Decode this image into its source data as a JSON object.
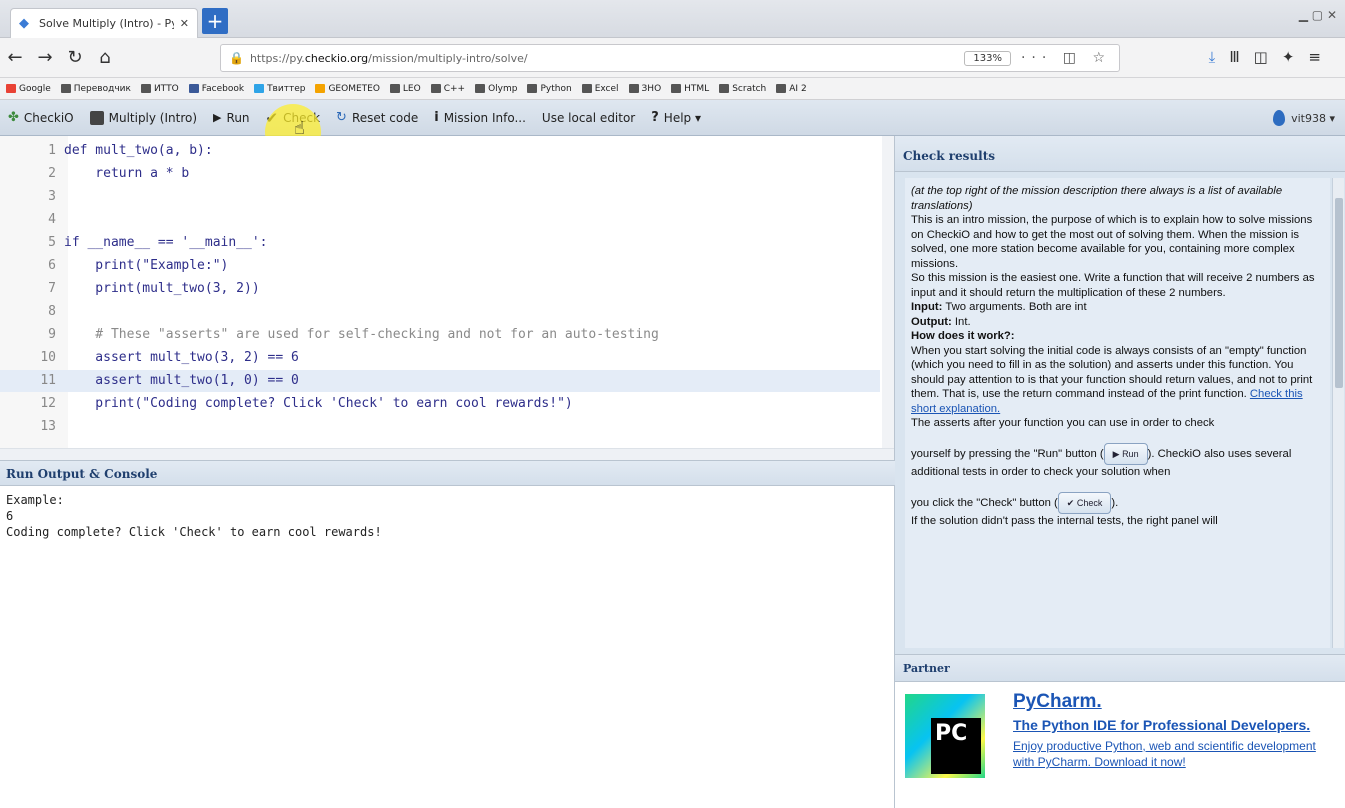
{
  "browser": {
    "tab_title": "Solve Multiply (Intro) - Py.CheckiO",
    "tab_close": "✕",
    "new_tab": "+",
    "url_prefix": "https://py.",
    "url_domain": "checkio.org",
    "url_path": "/mission/multiply-intro/solve/",
    "zoom": "133%",
    "url_more": "···"
  },
  "bookmarks": [
    {
      "label": "Google",
      "kind": "g"
    },
    {
      "label": "Переводчик",
      "kind": ""
    },
    {
      "label": "ИТТО",
      "kind": ""
    },
    {
      "label": "Facebook",
      "kind": "fb"
    },
    {
      "label": "Твиттер",
      "kind": "tw"
    },
    {
      "label": "GEOMETEO",
      "kind": "ge"
    },
    {
      "label": "LEO",
      "kind": ""
    },
    {
      "label": "C++",
      "kind": ""
    },
    {
      "label": "Olymp",
      "kind": ""
    },
    {
      "label": "Python",
      "kind": ""
    },
    {
      "label": "Excel",
      "kind": ""
    },
    {
      "label": "ЗНО",
      "kind": ""
    },
    {
      "label": "HTML",
      "kind": ""
    },
    {
      "label": "Scratch",
      "kind": ""
    },
    {
      "label": "AI 2",
      "kind": ""
    }
  ],
  "toolbar": {
    "logo": "CheckiO",
    "mission": "Multiply (Intro)",
    "run": "Run",
    "check": "Check",
    "reset": "Reset code",
    "mission_info": "Mission Info...",
    "local_editor": "Use local editor",
    "help": "Help",
    "user": "vit938"
  },
  "code_lines": [
    {
      "n": "1",
      "text": "def mult_two(a, b):"
    },
    {
      "n": "2",
      "text": "    return a * b"
    },
    {
      "n": "3",
      "text": ""
    },
    {
      "n": "4",
      "text": ""
    },
    {
      "n": "5",
      "text": "if __name__ == '__main__':"
    },
    {
      "n": "6",
      "text": "    print(\"Example:\")"
    },
    {
      "n": "7",
      "text": "    print(mult_two(3, 2))"
    },
    {
      "n": "8",
      "text": ""
    },
    {
      "n": "9",
      "text": "    # These \"asserts\" are used for self-checking and not for an auto-testing"
    },
    {
      "n": "10",
      "text": "    assert mult_two(3, 2) == 6"
    },
    {
      "n": "11",
      "text": "    assert mult_two(1, 0) == 0"
    },
    {
      "n": "12",
      "text": "    print(\"Coding complete? Click 'Check' to earn cool rewards!\")"
    },
    {
      "n": "13",
      "text": ""
    }
  ],
  "output": {
    "title": "Run Output & Console",
    "text": "Example:\n6\nCoding complete? Click 'Check' to earn cool rewards!"
  },
  "check_results": {
    "title": "Check results",
    "intro_italic": "(at the top right of the mission description there always is a list of available translations)",
    "p1": "This is an intro mission, the purpose of which is to explain how to solve missions on CheckiO and how to get the most out of solving them. When the mission is solved, one more station become available for you, containing more complex missions.",
    "p2": "So this mission is the easiest one. Write a function that will receive 2 numbers as input and it should return the multiplication of these 2 numbers.",
    "input_label": "Input:",
    "input_text": "Two arguments. Both are int",
    "output_label": "Output:",
    "output_text": "Int.",
    "how_label": "How does it work?:",
    "p3": "When you start solving the initial code is always consists of an \"empty\" function (which you need to fill in as the solution) and asserts under this function. You should pay attention to is that your function should return values, and not to print them. That is, use the return command instead of the print function.",
    "link": "Check this short explanation.",
    "p4": "The asserts after your function you can use in order to check",
    "p5a": "yourself by pressing the \"Run\" button (",
    "p5b": "). CheckiO also uses several additional tests in order to check your solution when",
    "p6a": "you click the \"Check\" button (",
    "p6b": ").",
    "p7": "If the solution didn't pass the internal tests, the right panel will",
    "btn_run": "▶ Run",
    "btn_check": "✔ Check"
  },
  "partner": {
    "title": "Partner",
    "logo_text": "PC",
    "name": "PyCharm.",
    "tagline": "The Python IDE for Professional Developers.",
    "desc": "Enjoy productive Python, web and scientific development with PyCharm. Download it now!"
  }
}
